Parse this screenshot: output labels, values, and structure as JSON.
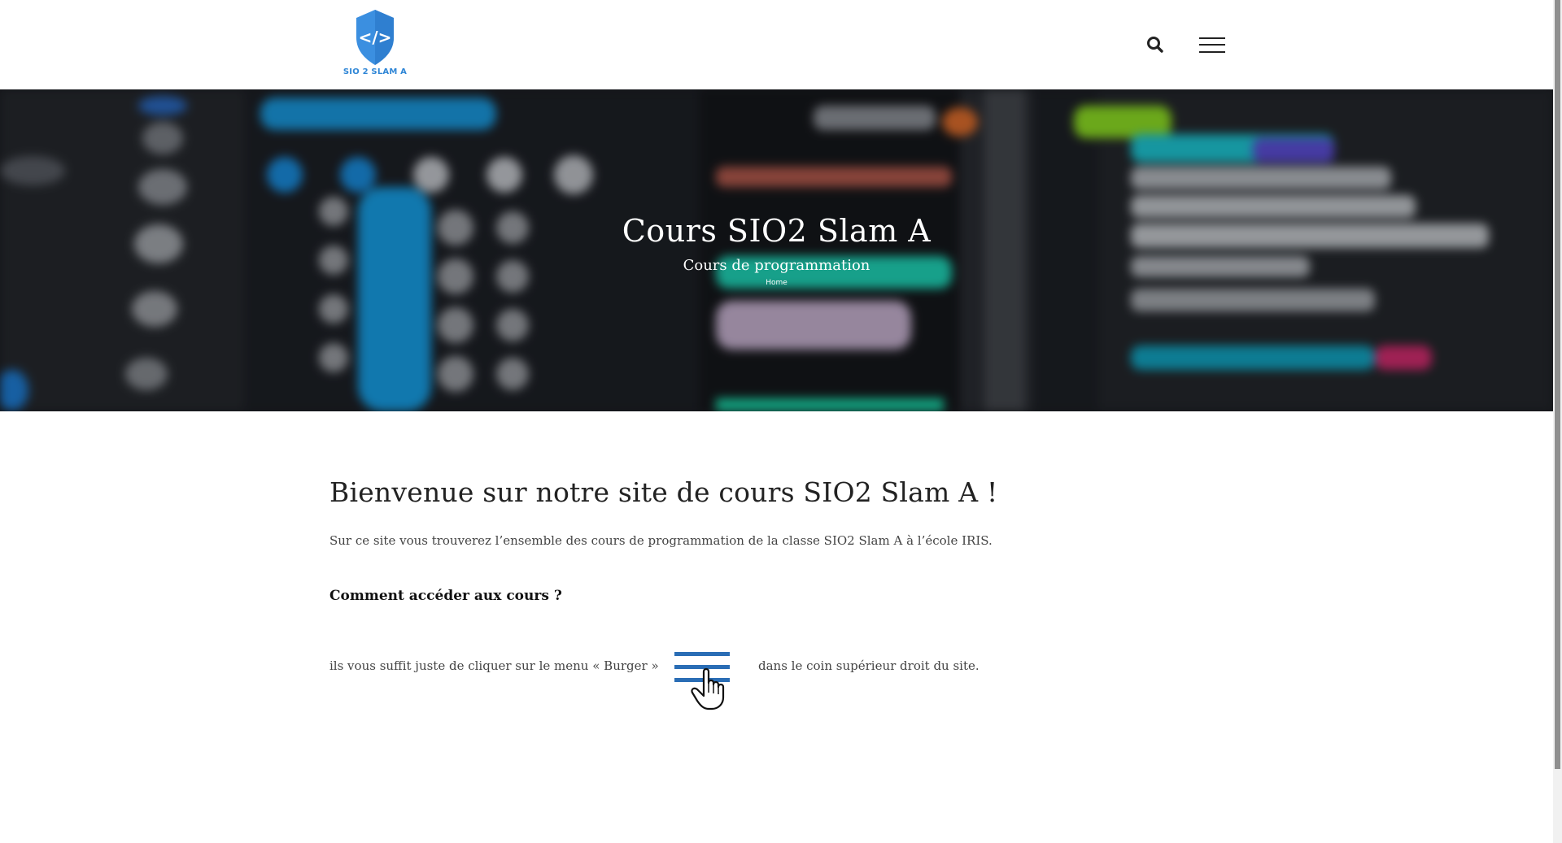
{
  "header": {
    "logo_text": "SIO 2 SLAM A",
    "logo_code_symbol": "</>",
    "search_icon": "search-icon",
    "menu_icon": "hamburger-menu-icon"
  },
  "hero": {
    "title": "Cours SIO2 Slam A",
    "subtitle": "Cours de programmation",
    "breadcrumb": "Home"
  },
  "content": {
    "heading": "Bienvenue sur notre site de cours SIO2 Slam A !",
    "intro": "Sur ce site vous trouverez l’ensemble des cours de programmation de la classe SIO2 Slam A à l’école IRIS.",
    "subheading": "Comment accéder aux cours ?",
    "instruction_before": "ils vous suffit juste de cliquer sur le menu « Burger »",
    "instruction_after": "dans le coin supérieur droit du site.",
    "illustration_icon": "burger-menu-click-icon"
  },
  "colors": {
    "brand_blue": "#2f86d6",
    "burger_illustration_blue": "#2a6db5"
  }
}
